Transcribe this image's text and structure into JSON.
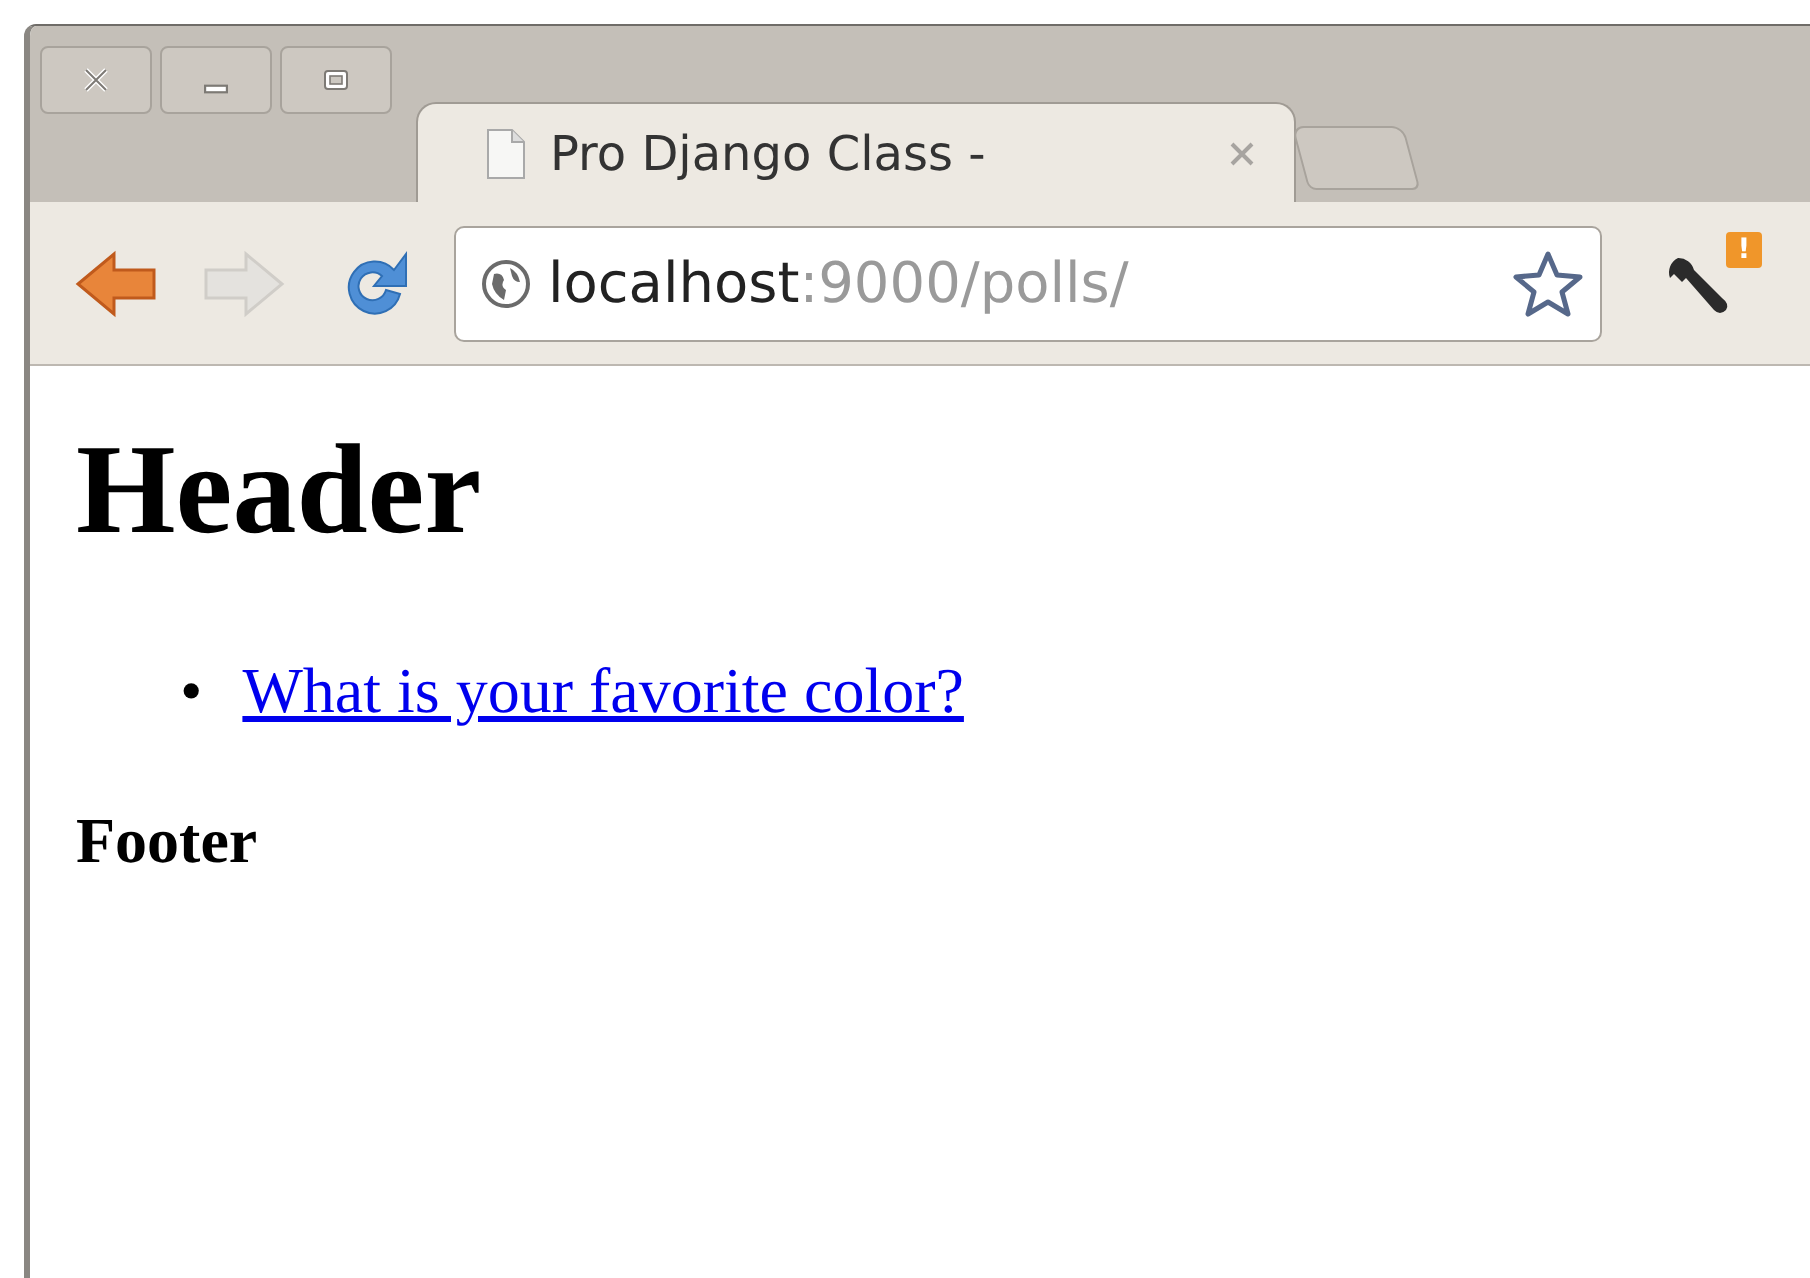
{
  "tabs": [
    {
      "title": "Pro Django Class -",
      "selected": true
    }
  ],
  "address": {
    "host": "localhost",
    "path": ":9000/polls/"
  },
  "menu_badge": "!",
  "page": {
    "heading": "Header",
    "links": [
      {
        "bullet": "•",
        "text": "What is your favorite color?"
      }
    ],
    "footer": "Footer"
  }
}
